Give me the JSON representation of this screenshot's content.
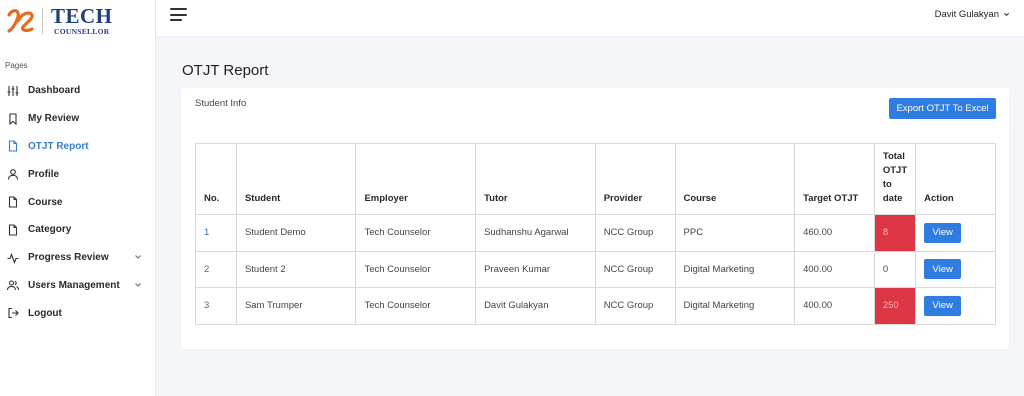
{
  "brand": {
    "name": "TECH",
    "tagline": "COUNSELLOR",
    "logo_icon": "tc-monogram-icon",
    "accent": "#e86a1c",
    "primary": "#1f3f7a"
  },
  "sidebar": {
    "section_label": "Pages",
    "items": [
      {
        "label": "Dashboard",
        "icon": "sliders-icon",
        "active": false,
        "chevron": false
      },
      {
        "label": "My Review",
        "icon": "bookmark-icon",
        "active": false,
        "chevron": false
      },
      {
        "label": "OTJT Report",
        "icon": "file-icon",
        "active": true,
        "chevron": false
      },
      {
        "label": "Profile",
        "icon": "user-icon",
        "active": false,
        "chevron": false
      },
      {
        "label": "Course",
        "icon": "file-icon",
        "active": false,
        "chevron": false
      },
      {
        "label": "Category",
        "icon": "file-icon",
        "active": false,
        "chevron": false
      },
      {
        "label": "Progress Review",
        "icon": "activity-icon",
        "active": false,
        "chevron": true
      },
      {
        "label": "Users Management",
        "icon": "users-icon",
        "active": false,
        "chevron": true
      },
      {
        "label": "Logout",
        "icon": "logout-icon",
        "active": false,
        "chevron": false
      }
    ]
  },
  "topbar": {
    "user_name": "Davit Gulakyan"
  },
  "page": {
    "title": "OTJT Report"
  },
  "card": {
    "title": "Student Info",
    "export_label": "Export OTJT To Excel"
  },
  "table": {
    "headers": [
      "No.",
      "Student",
      "Employer",
      "Tutor",
      "Provider",
      "Course",
      "Target OTJT",
      "Total\nOTJT\nto\ndate",
      "Action"
    ],
    "rows": [
      {
        "no": "1",
        "student": "Student Demo",
        "employer": "Tech Counselor",
        "tutor": "Sudhanshu Agarwal",
        "provider": "NCC Group",
        "course": "PPC",
        "target": "460.00",
        "total": "8",
        "total_alert": true,
        "action": "View"
      },
      {
        "no": "2",
        "student": "Student 2",
        "employer": "Tech Counselor",
        "tutor": "Praveen Kumar",
        "provider": "NCC Group",
        "course": "Digital Marketing",
        "target": "400.00",
        "total": "0",
        "total_alert": false,
        "action": "View"
      },
      {
        "no": "3",
        "student": "Sam Trumper",
        "employer": "Tech Counselor",
        "tutor": "Davit Gulakyan",
        "provider": "NCC Group",
        "course": "Digital Marketing",
        "target": "400.00",
        "total": "250",
        "total_alert": true,
        "action": "View"
      }
    ]
  },
  "colors": {
    "button": "#2f7de1",
    "active_nav": "#3a7bd5",
    "alert_cell": "#dc3545"
  }
}
